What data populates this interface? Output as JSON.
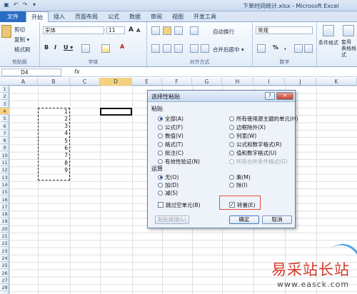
{
  "app": {
    "title": "下单时间统计.xlsx - Microsoft Excel"
  },
  "qat": {
    "save_glyph": "▣",
    "undo_glyph": "↶",
    "redo_glyph": "↷",
    "more_glyph": "▾"
  },
  "tabs": [
    "文件",
    "开始",
    "插入",
    "页面布局",
    "公式",
    "数据",
    "审阅",
    "视图",
    "开发工具"
  ],
  "ribbon": {
    "clipboard": {
      "cut": "剪切",
      "copy": "复制 ▾",
      "format_painter": "格式刷",
      "label": "剪贴板"
    },
    "font": {
      "name": "宋体",
      "size": "11",
      "grow": "A",
      "shrink": "A",
      "bold": "B",
      "italic": "I",
      "underline": "U ▾",
      "font_color": "A",
      "label": "字体"
    },
    "alignment": {
      "wrap": "自动换行",
      "merge": "合并后居中 ▾",
      "label": "对齐方式"
    },
    "number": {
      "format": "常规",
      "percent": "%",
      "comma": ",",
      "currency": "▾",
      "label": "数字"
    },
    "styles": {
      "conditional": "条件格式",
      "table": "套用\n表格格式"
    }
  },
  "formula_bar": {
    "name_box": "D4",
    "fx": "fx"
  },
  "grid": {
    "columns": [
      "A",
      "B",
      "C",
      "D",
      "E",
      "F",
      "G",
      "H",
      "I",
      "J",
      "K"
    ],
    "rows": [
      "1",
      "2",
      "3",
      "4",
      "5",
      "6",
      "7",
      "8",
      "9",
      "10",
      "11",
      "12",
      "13",
      "14",
      "15",
      "16",
      "17",
      "18",
      "19",
      "20",
      "21",
      "22",
      "23",
      "24",
      "25",
      "26",
      "27",
      "28"
    ],
    "values": [
      "1",
      "2",
      "3",
      "4",
      "5",
      "6",
      "7",
      "8",
      "9"
    ]
  },
  "dialog": {
    "title": "选择性粘贴",
    "help": "?",
    "close": "✕",
    "paste_section": "粘贴",
    "paste_options_left": [
      "全部(A)",
      "公式(F)",
      "数值(V)",
      "格式(T)",
      "批注(C)",
      "有效性验证(N)"
    ],
    "paste_options_right": [
      "所有使用源主题的单元(H)",
      "边框除外(X)",
      "列宽(W)",
      "公式和数字格式(R)",
      "值和数字格式(U)",
      "所有合并条件格式(G)"
    ],
    "operation_section": "运算",
    "operation_left": [
      "无(O)",
      "加(D)",
      "减(S)"
    ],
    "operation_right": [
      "乘(M)",
      "除(I)"
    ],
    "skip_blanks": "跳过空单元(B)",
    "transpose": "转置(E)",
    "transpose_mark": "✓",
    "paste_link": "粘贴链接(L)",
    "ok": "确定",
    "cancel": "取消"
  },
  "watermark": {
    "cn": "易采站长站",
    "url": "www.easck.com"
  }
}
